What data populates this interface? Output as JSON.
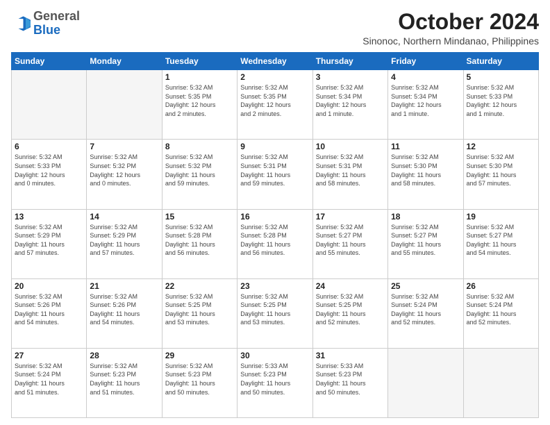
{
  "header": {
    "logo": {
      "general": "General",
      "blue": "Blue"
    },
    "title": "October 2024",
    "subtitle": "Sinonoc, Northern Mindanao, Philippines"
  },
  "calendar": {
    "days_of_week": [
      "Sunday",
      "Monday",
      "Tuesday",
      "Wednesday",
      "Thursday",
      "Friday",
      "Saturday"
    ],
    "weeks": [
      [
        {
          "day": "",
          "info": ""
        },
        {
          "day": "",
          "info": ""
        },
        {
          "day": "1",
          "info": "Sunrise: 5:32 AM\nSunset: 5:35 PM\nDaylight: 12 hours\nand 2 minutes."
        },
        {
          "day": "2",
          "info": "Sunrise: 5:32 AM\nSunset: 5:35 PM\nDaylight: 12 hours\nand 2 minutes."
        },
        {
          "day": "3",
          "info": "Sunrise: 5:32 AM\nSunset: 5:34 PM\nDaylight: 12 hours\nand 1 minute."
        },
        {
          "day": "4",
          "info": "Sunrise: 5:32 AM\nSunset: 5:34 PM\nDaylight: 12 hours\nand 1 minute."
        },
        {
          "day": "5",
          "info": "Sunrise: 5:32 AM\nSunset: 5:33 PM\nDaylight: 12 hours\nand 1 minute."
        }
      ],
      [
        {
          "day": "6",
          "info": "Sunrise: 5:32 AM\nSunset: 5:33 PM\nDaylight: 12 hours\nand 0 minutes."
        },
        {
          "day": "7",
          "info": "Sunrise: 5:32 AM\nSunset: 5:32 PM\nDaylight: 12 hours\nand 0 minutes."
        },
        {
          "day": "8",
          "info": "Sunrise: 5:32 AM\nSunset: 5:32 PM\nDaylight: 11 hours\nand 59 minutes."
        },
        {
          "day": "9",
          "info": "Sunrise: 5:32 AM\nSunset: 5:31 PM\nDaylight: 11 hours\nand 59 minutes."
        },
        {
          "day": "10",
          "info": "Sunrise: 5:32 AM\nSunset: 5:31 PM\nDaylight: 11 hours\nand 58 minutes."
        },
        {
          "day": "11",
          "info": "Sunrise: 5:32 AM\nSunset: 5:30 PM\nDaylight: 11 hours\nand 58 minutes."
        },
        {
          "day": "12",
          "info": "Sunrise: 5:32 AM\nSunset: 5:30 PM\nDaylight: 11 hours\nand 57 minutes."
        }
      ],
      [
        {
          "day": "13",
          "info": "Sunrise: 5:32 AM\nSunset: 5:29 PM\nDaylight: 11 hours\nand 57 minutes."
        },
        {
          "day": "14",
          "info": "Sunrise: 5:32 AM\nSunset: 5:29 PM\nDaylight: 11 hours\nand 57 minutes."
        },
        {
          "day": "15",
          "info": "Sunrise: 5:32 AM\nSunset: 5:28 PM\nDaylight: 11 hours\nand 56 minutes."
        },
        {
          "day": "16",
          "info": "Sunrise: 5:32 AM\nSunset: 5:28 PM\nDaylight: 11 hours\nand 56 minutes."
        },
        {
          "day": "17",
          "info": "Sunrise: 5:32 AM\nSunset: 5:27 PM\nDaylight: 11 hours\nand 55 minutes."
        },
        {
          "day": "18",
          "info": "Sunrise: 5:32 AM\nSunset: 5:27 PM\nDaylight: 11 hours\nand 55 minutes."
        },
        {
          "day": "19",
          "info": "Sunrise: 5:32 AM\nSunset: 5:27 PM\nDaylight: 11 hours\nand 54 minutes."
        }
      ],
      [
        {
          "day": "20",
          "info": "Sunrise: 5:32 AM\nSunset: 5:26 PM\nDaylight: 11 hours\nand 54 minutes."
        },
        {
          "day": "21",
          "info": "Sunrise: 5:32 AM\nSunset: 5:26 PM\nDaylight: 11 hours\nand 54 minutes."
        },
        {
          "day": "22",
          "info": "Sunrise: 5:32 AM\nSunset: 5:25 PM\nDaylight: 11 hours\nand 53 minutes."
        },
        {
          "day": "23",
          "info": "Sunrise: 5:32 AM\nSunset: 5:25 PM\nDaylight: 11 hours\nand 53 minutes."
        },
        {
          "day": "24",
          "info": "Sunrise: 5:32 AM\nSunset: 5:25 PM\nDaylight: 11 hours\nand 52 minutes."
        },
        {
          "day": "25",
          "info": "Sunrise: 5:32 AM\nSunset: 5:24 PM\nDaylight: 11 hours\nand 52 minutes."
        },
        {
          "day": "26",
          "info": "Sunrise: 5:32 AM\nSunset: 5:24 PM\nDaylight: 11 hours\nand 52 minutes."
        }
      ],
      [
        {
          "day": "27",
          "info": "Sunrise: 5:32 AM\nSunset: 5:24 PM\nDaylight: 11 hours\nand 51 minutes."
        },
        {
          "day": "28",
          "info": "Sunrise: 5:32 AM\nSunset: 5:23 PM\nDaylight: 11 hours\nand 51 minutes."
        },
        {
          "day": "29",
          "info": "Sunrise: 5:32 AM\nSunset: 5:23 PM\nDaylight: 11 hours\nand 50 minutes."
        },
        {
          "day": "30",
          "info": "Sunrise: 5:33 AM\nSunset: 5:23 PM\nDaylight: 11 hours\nand 50 minutes."
        },
        {
          "day": "31",
          "info": "Sunrise: 5:33 AM\nSunset: 5:23 PM\nDaylight: 11 hours\nand 50 minutes."
        },
        {
          "day": "",
          "info": ""
        },
        {
          "day": "",
          "info": ""
        }
      ]
    ]
  }
}
